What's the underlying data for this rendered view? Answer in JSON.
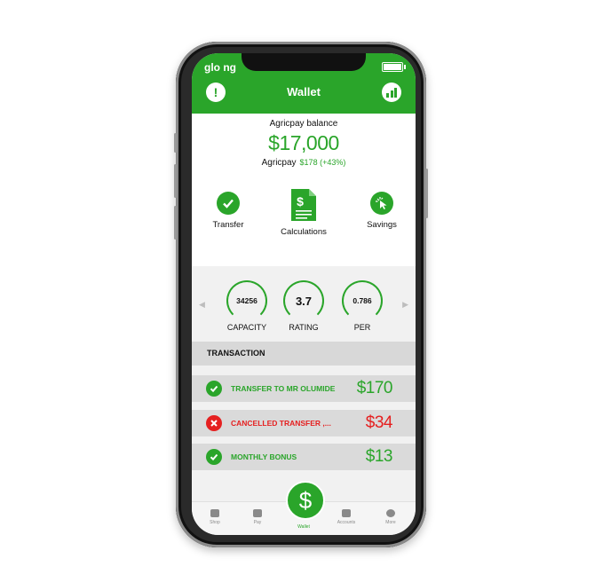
{
  "status_bar": {
    "carrier": "glo ng"
  },
  "header": {
    "title": "Wallet",
    "alert_icon": "exclamation-icon",
    "stats_icon": "bar-chart-icon"
  },
  "balance": {
    "label": "Agricpay balance",
    "amount": "$17,000",
    "sub_label": "Agricpay",
    "change": "$178 (+43%)"
  },
  "actions": [
    {
      "label": "Transfer",
      "icon": "check-circle-icon"
    },
    {
      "label": "Calculations",
      "icon": "dollar-document-icon"
    },
    {
      "label": "Savings",
      "icon": "cursor-click-icon"
    }
  ],
  "stats": [
    {
      "value": "34256",
      "label": "CAPACITY"
    },
    {
      "value": "3.7",
      "label": "RATING"
    },
    {
      "value": "0.786",
      "label": "PER"
    }
  ],
  "transactions": {
    "header": "TRANSACTION",
    "items": [
      {
        "label": "TRANSFER TO MR OLUMIDE",
        "amount": "$170",
        "status": "success"
      },
      {
        "label": "CANCELLED TRANSFER ,...",
        "amount": "$34",
        "status": "cancelled"
      },
      {
        "label": "MONTHLY BONUS",
        "amount": "$13",
        "status": "success"
      }
    ]
  },
  "tabbar": {
    "fab_symbol": "$",
    "tabs": [
      {
        "label": "Shop",
        "icon": "basket-icon"
      },
      {
        "label": "Pay",
        "icon": "users-icon"
      },
      {
        "label": "Wallet",
        "icon": "wallet-icon"
      },
      {
        "label": "Accounts",
        "icon": "user-icon"
      },
      {
        "label": "More",
        "icon": "more-icon"
      }
    ]
  },
  "colors": {
    "primary": "#2aa52a",
    "danger": "#e52020"
  }
}
